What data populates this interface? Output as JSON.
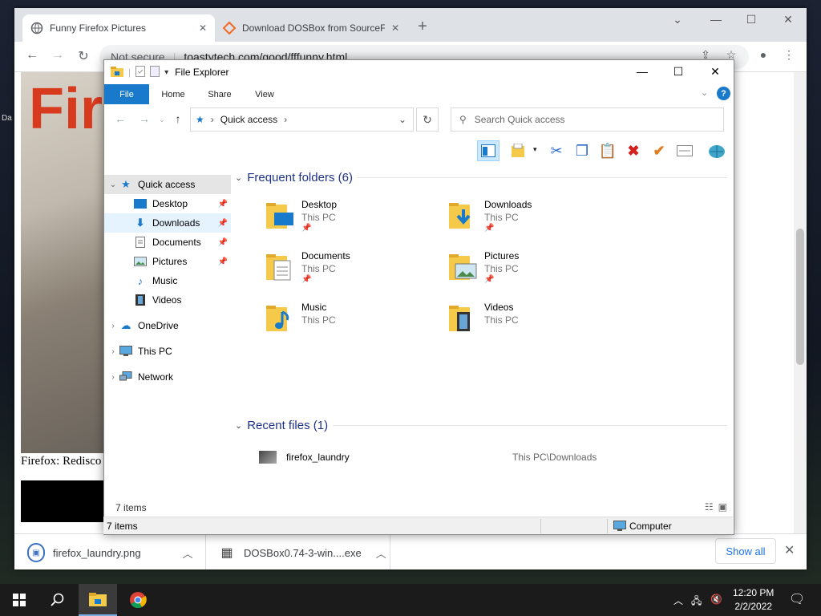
{
  "desktop": {
    "label": "Da"
  },
  "browser": {
    "tabs": [
      {
        "title": "Funny Firefox Pictures",
        "active": true
      },
      {
        "title": "Download DOSBox from SourceF",
        "active": false
      }
    ],
    "new_tab": "+",
    "url_security": "Not secure",
    "url": "toastytech.com/good/fffunny.html",
    "page": {
      "brand_text": "Fir",
      "caption": "Firefox: Redisco"
    },
    "downloads": [
      {
        "name": "firefox_laundry.png"
      },
      {
        "name": "DOSBox0.74-3-win....exe"
      }
    ],
    "show_all": "Show all"
  },
  "explorer": {
    "title": "File Explorer",
    "ribbon_tabs": [
      "File",
      "Home",
      "Share",
      "View"
    ],
    "breadcrumb": "Quick access",
    "search_placeholder": "Search Quick access",
    "nav": {
      "quick_access": "Quick access",
      "pinned": [
        "Desktop",
        "Downloads",
        "Documents",
        "Pictures"
      ],
      "unpinned": [
        "Music",
        "Videos"
      ],
      "onedrive": "OneDrive",
      "this_pc": "This PC",
      "network": "Network"
    },
    "frequent_header": "Frequent folders (6)",
    "folders": [
      {
        "name": "Desktop",
        "location": "This PC",
        "pinned": true
      },
      {
        "name": "Downloads",
        "location": "This PC",
        "pinned": true
      },
      {
        "name": "Documents",
        "location": "This PC",
        "pinned": true
      },
      {
        "name": "Pictures",
        "location": "This PC",
        "pinned": true
      },
      {
        "name": "Music",
        "location": "This PC",
        "pinned": false
      },
      {
        "name": "Videos",
        "location": "This PC",
        "pinned": false
      }
    ],
    "recent_header": "Recent files (1)",
    "recent": [
      {
        "name": "firefox_laundry",
        "path": "This PC\\Downloads"
      }
    ],
    "status_items": "7 items"
  },
  "browser_status": {
    "items": "7 items",
    "zone": "Computer"
  },
  "taskbar": {
    "time": "12:20 PM",
    "date": "2/2/2022"
  },
  "colors": {
    "accent": "#1979ca",
    "header_text": "#1e3287",
    "folder": "#f5c94a"
  }
}
